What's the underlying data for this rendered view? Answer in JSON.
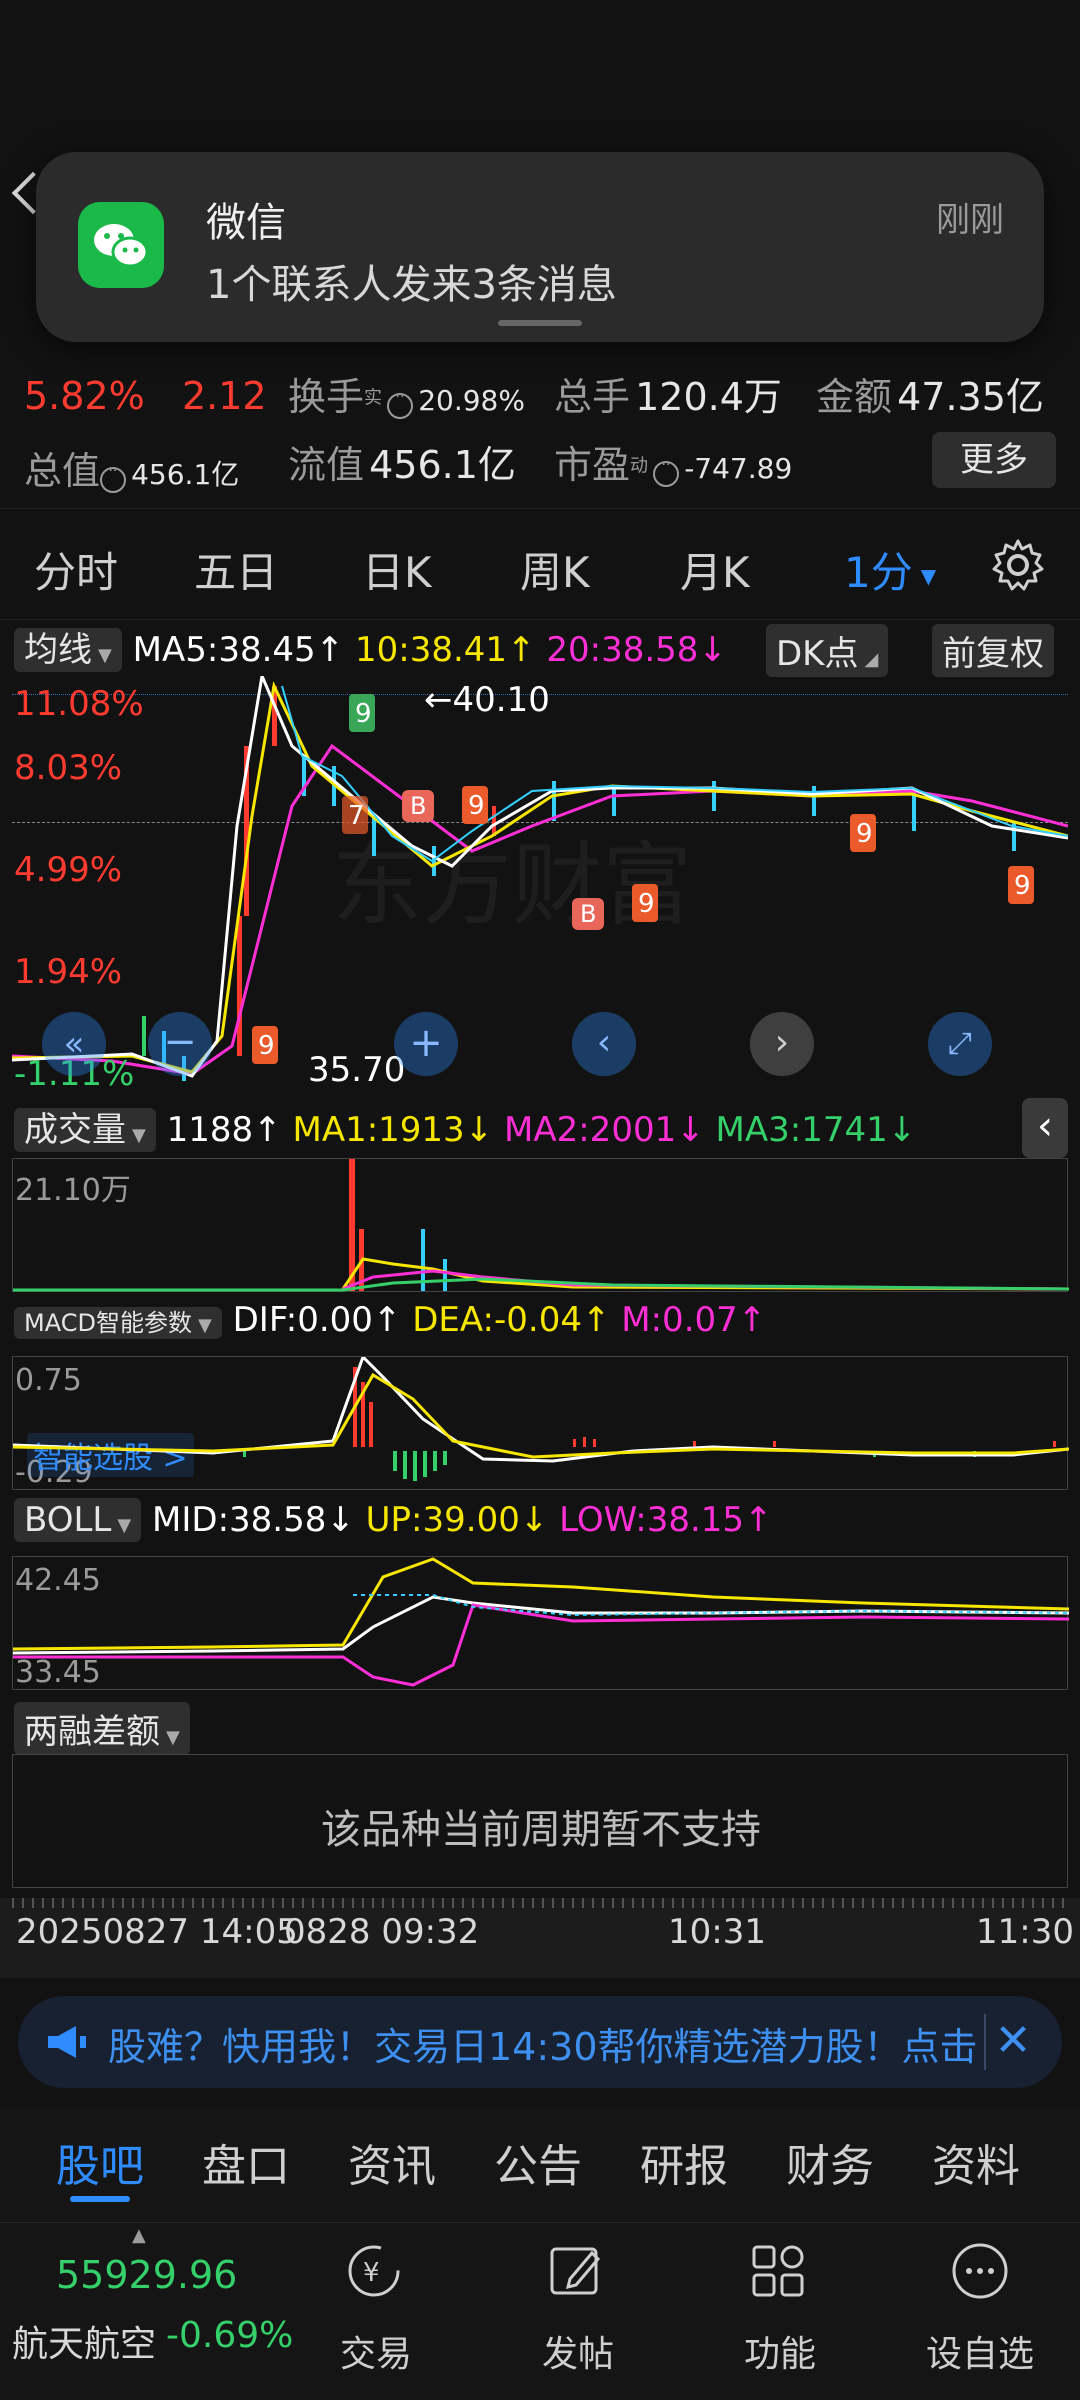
{
  "notification": {
    "app": "微信",
    "message": "1个联系人发来3条消息",
    "time": "刚刚"
  },
  "quote": {
    "change_pct": "5.82%",
    "change": "2.12",
    "turnover_label": "换手",
    "turnover_sup": "实",
    "turnover": "20.98%",
    "volume_label": "总手",
    "volume": "120.4万",
    "amount_label": "金额",
    "amount": "47.35亿",
    "total_mv_label": "总值",
    "total_mv": "456.1亿",
    "float_mv_label": "流值",
    "float_mv": "456.1亿",
    "pe_label": "市盈",
    "pe_sup": "动",
    "pe": "-747.89",
    "more_label": "更多"
  },
  "period_tabs": [
    "分时",
    "五日",
    "日K",
    "周K",
    "月K",
    "1分"
  ],
  "ma": {
    "chip": "均线",
    "ma5": "MA5:38.45↑",
    "ma10": "10:38.41↑",
    "ma20": "20:38.58↓",
    "dk": "DK点",
    "adjust": "前复权"
  },
  "price_axis": [
    "11.08%",
    "8.03%",
    "4.99%",
    "1.94%",
    "-1.11%"
  ],
  "price_marks": {
    "high": "40.10",
    "low": "35.70"
  },
  "volume": {
    "chip": "成交量",
    "value": "1188↑",
    "ma1": "MA1:1913↓",
    "ma2": "MA2:2001↓",
    "ma3": "MA3:1741↓",
    "axis_top": "21.10万"
  },
  "macd": {
    "chip": "MACD智能参数",
    "dif": "DIF:0.00↑",
    "dea": "DEA:-0.04↑",
    "m": "M:0.07↑",
    "axis_top": "0.75",
    "axis_bottom": "-0.29",
    "overlay": "智能选股 >"
  },
  "boll": {
    "chip": "BOLL",
    "mid": "MID:38.58↓",
    "up": "UP:39.00↓",
    "low": "LOW:38.15↑",
    "axis_top": "42.45",
    "axis_bottom": "33.45"
  },
  "margin": {
    "chip": "两融差额",
    "empty_text": "该品种当前周期暂不支持"
  },
  "time_axis": [
    "20250827 14:05",
    "0828 09:32",
    "10:31",
    "11:30"
  ],
  "promo": {
    "text": "股难？快用我！交易日14:30帮你精选潜力股！点击"
  },
  "sub_tabs": [
    "股吧",
    "盘口",
    "资讯",
    "公告",
    "研报",
    "财务",
    "资料"
  ],
  "bottom": {
    "index_value": "55929.96",
    "index_name": "航天航空",
    "index_change": "-0.69%",
    "actions": [
      "交易",
      "发帖",
      "功能",
      "设自选"
    ]
  },
  "colors": {
    "up": "#ff3b30",
    "down": "#35d06a",
    "ma5": "#ffffff",
    "ma10": "#f7e600",
    "ma20": "#ff2fd6",
    "accent": "#2f8cff"
  }
}
